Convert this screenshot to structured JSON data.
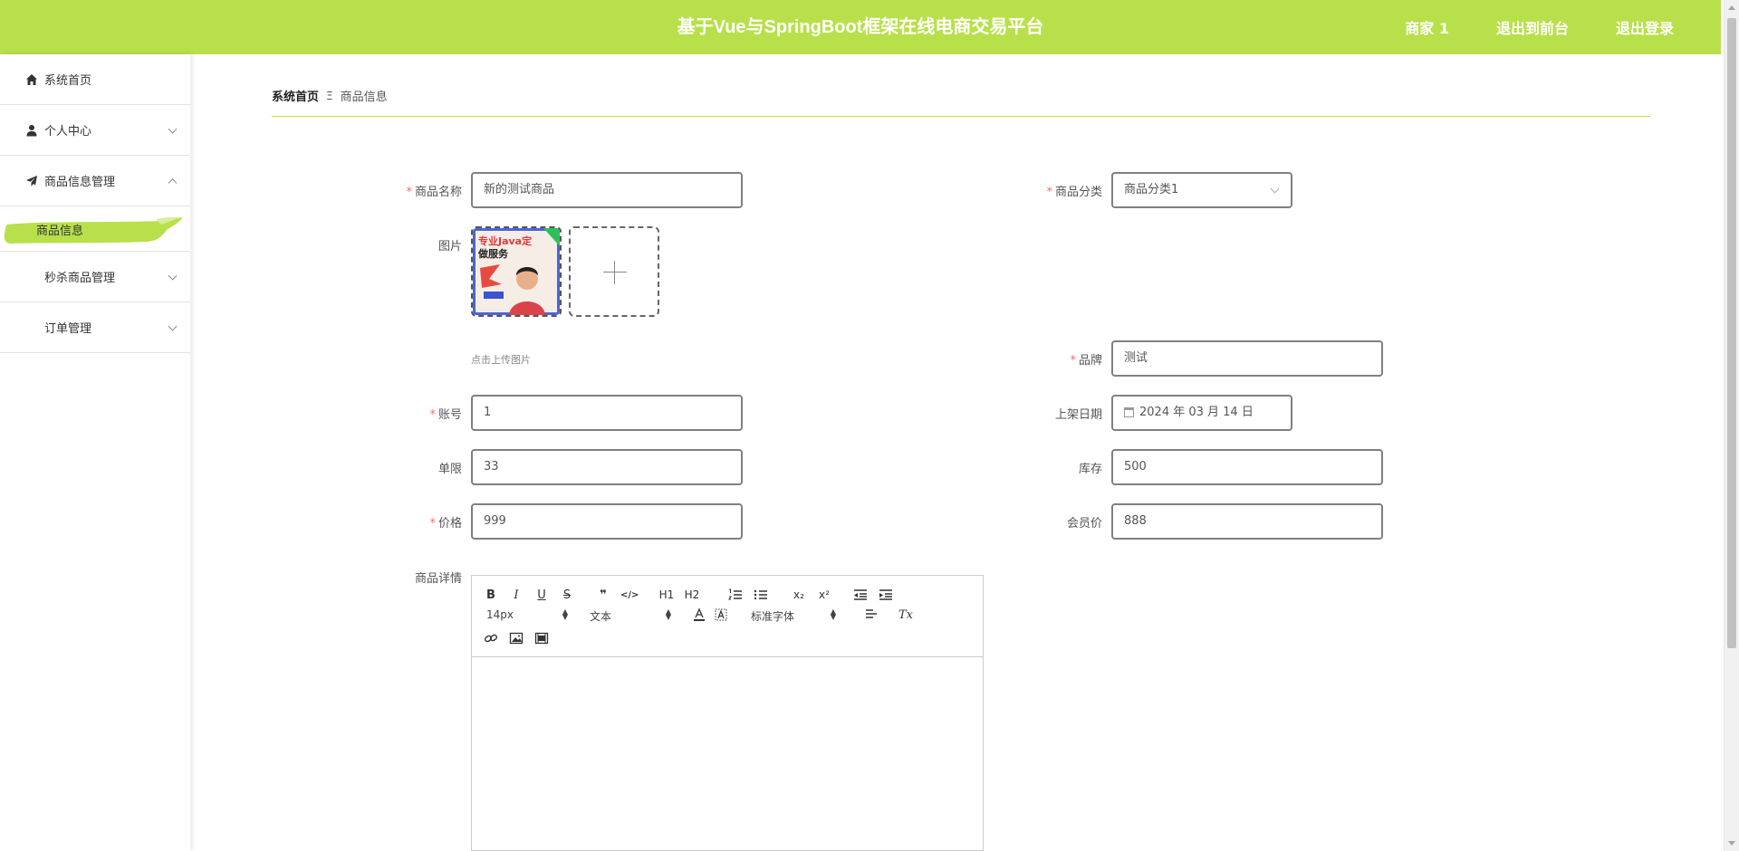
{
  "header": {
    "title": "基于Vue与SpringBoot框架在线电商交易平台",
    "nav": [
      "商家 1",
      "退出到前台",
      "退出登录"
    ],
    "bg_color": "#b8e04a"
  },
  "sidebar": {
    "items": [
      {
        "label": "系统首页",
        "icon": "home-icon"
      },
      {
        "label": "个人中心",
        "icon": "user-icon"
      },
      {
        "label": "商品信息管理",
        "icon": "send-icon",
        "expanded": true
      },
      {
        "label": "秒杀商品管理",
        "icon": "grid-icon"
      },
      {
        "label": "订单管理",
        "icon": "grid-icon"
      }
    ],
    "submenu_active": "商品信息"
  },
  "breadcrumb": {
    "home": "系统首页",
    "separator": "Ξ",
    "current": "商品信息"
  },
  "form": {
    "name_label": "商品名称",
    "name_value": "新的测试商品",
    "category_label": "商品分类",
    "category_value": "商品分类1",
    "image_label": "图片",
    "image_hint": "点击上传图片",
    "thumb_text_1": "专业Java定",
    "thumb_text_2": "做服务",
    "brand_label": "品牌",
    "brand_value": "测试",
    "account_label": "账号",
    "account_value": "1",
    "date_label": "上架日期",
    "date_value": "2024 年 03 月 14 日",
    "limit_label": "单限",
    "limit_value": "33",
    "stock_label": "库存",
    "stock_value": "500",
    "price_label": "价格",
    "price_value": "999",
    "member_price_label": "会员价",
    "member_price_value": "888",
    "detail_label": "商品详情",
    "required_mark": "*"
  },
  "editor": {
    "btn_bold": "B",
    "btn_italic": "I",
    "btn_underline": "U",
    "btn_strike": "S",
    "btn_quote": "❞",
    "btn_code": "</>",
    "btn_h1": "H1",
    "btn_h2": "H2",
    "btn_sub": "x₂",
    "btn_sup": "x²",
    "btn_clean": "Tx",
    "size_value": "14px",
    "header_value": "文本",
    "font_value": "标准字体"
  }
}
